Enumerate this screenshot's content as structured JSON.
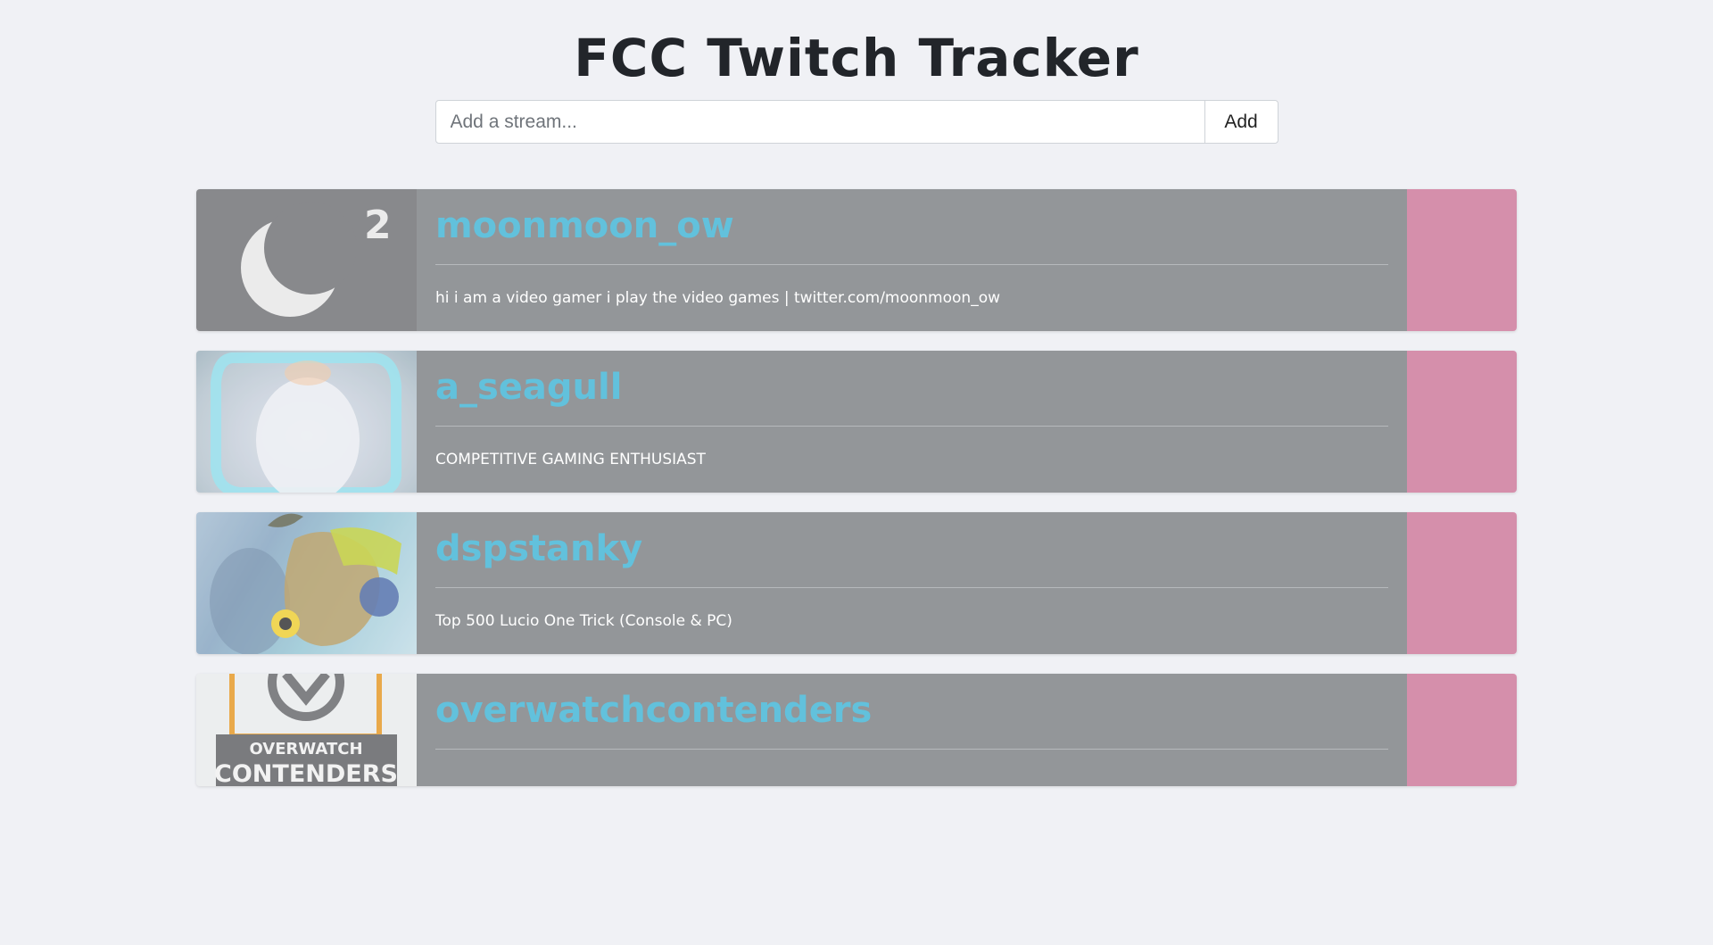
{
  "header": {
    "title": "FCC Twitch Tracker"
  },
  "search": {
    "placeholder": "Add a stream...",
    "value": "",
    "add_label": "Add"
  },
  "colors": {
    "name": "#62c1dc",
    "card": "#939699",
    "status_offline": "#d58fab",
    "background": "#f0f1f5"
  },
  "streams": [
    {
      "name": "moonmoon_ow",
      "description": "hi i am a video gamer i play the video games | twitter.com/moonmoon_ow",
      "thumb_icon": "moon-logo-icon",
      "thumb_badge": "2"
    },
    {
      "name": "a_seagull",
      "description": "COMPETITIVE GAMING ENTHUSIAST",
      "thumb_icon": "seagull-avatar-icon"
    },
    {
      "name": "dspstanky",
      "description": "Top 500 Lucio One Trick (Console & PC)",
      "thumb_icon": "lucio-avatar-icon"
    },
    {
      "name": "overwatchcontenders",
      "description": "",
      "thumb_icon": "overwatch-contenders-logo-icon",
      "thumb_text_top": "OVERWATCH",
      "thumb_text_bottom": "CONTENDERS"
    }
  ]
}
